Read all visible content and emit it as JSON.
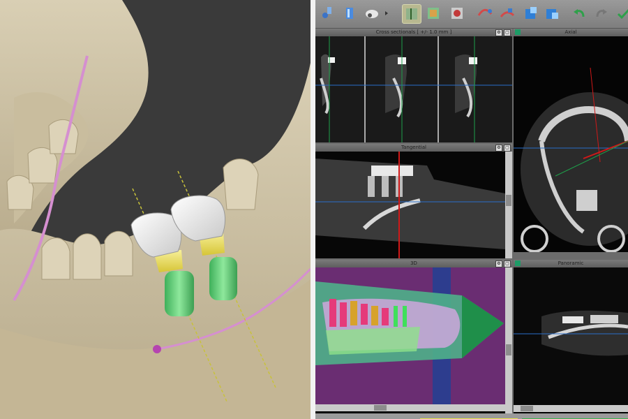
{
  "left_view": {
    "description_label": "3D jaw render with implants"
  },
  "toolbar": {
    "buttons": [
      {
        "name": "implant-tool",
        "icon": "implant-icon"
      },
      {
        "name": "abutment-tool",
        "icon": "abutment-icon"
      },
      {
        "name": "crown-tool",
        "icon": "crown-icon"
      },
      {
        "name": "view-mode-1",
        "icon": "slice-view-icon"
      },
      {
        "name": "view-mode-2",
        "icon": "volume-view-icon"
      },
      {
        "name": "view-mode-3",
        "icon": "render-view-icon"
      },
      {
        "name": "nerve-tool",
        "icon": "nerve-icon"
      },
      {
        "name": "measure-tool",
        "icon": "measure-icon"
      },
      {
        "name": "export-tool",
        "icon": "export-icon"
      },
      {
        "name": "import-tool",
        "icon": "import-icon"
      },
      {
        "name": "undo",
        "icon": "undo-icon"
      },
      {
        "name": "redo",
        "icon": "redo-icon"
      },
      {
        "name": "accept",
        "icon": "accept-icon"
      }
    ]
  },
  "panels": {
    "cross_sectionals": {
      "title": "Cross sectionals [ +/- 1.0 mm ]"
    },
    "axial": {
      "title": "Axial"
    },
    "tangential": {
      "title": "Tangential"
    },
    "view_3d": {
      "title": "3D"
    },
    "panoramic": {
      "title": "Panoramic"
    }
  },
  "colors": {
    "toolbar_bg": "#8a8a8a",
    "panel_title": "#6b6b6b",
    "crosshair_green": "#1ea04a",
    "crosshair_blue": "#2a6fc9",
    "crosshair_red": "#d01818",
    "status_bar_yellow": "#e6e24a",
    "status_bar_green": "#39b54a"
  }
}
